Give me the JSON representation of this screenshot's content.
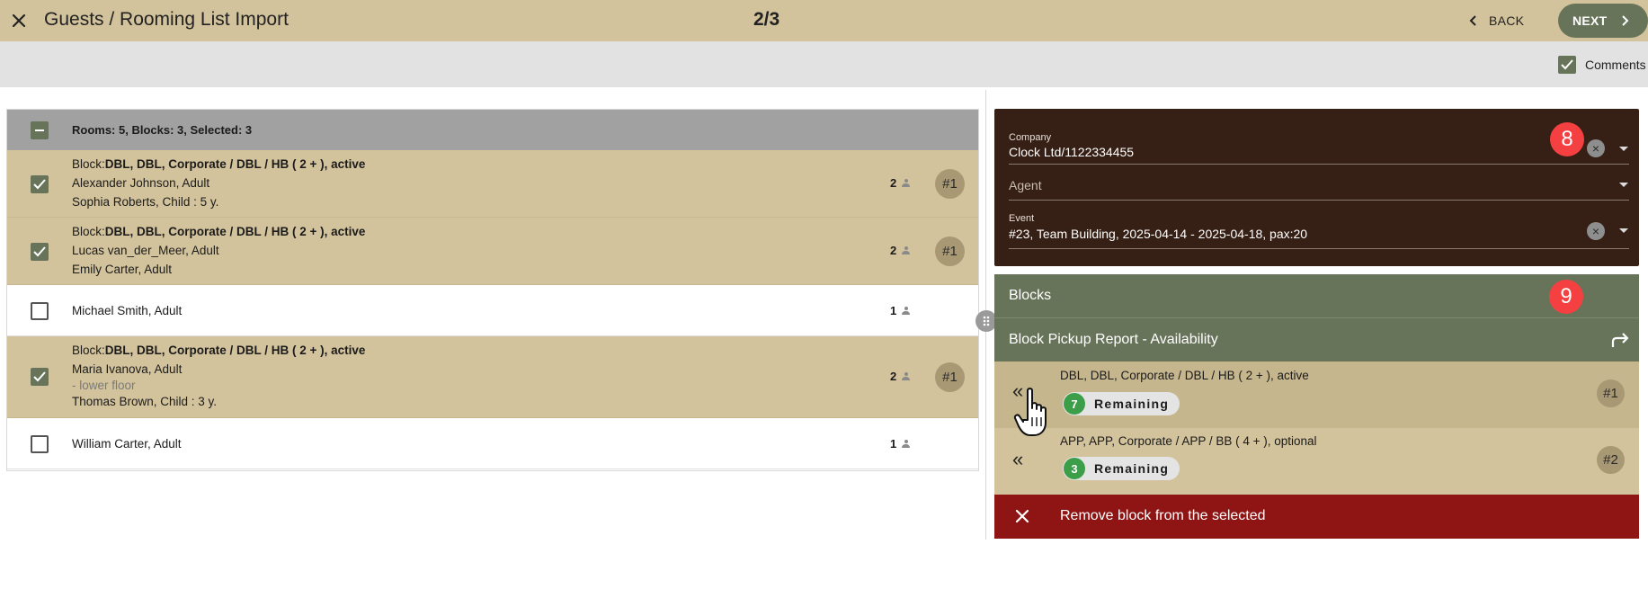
{
  "header": {
    "title": "Guests / Rooming List Import",
    "step": "2/3",
    "back_label": "BACK",
    "next_label": "NEXT"
  },
  "toolbar": {
    "comments_label": "Comments",
    "comments_checked": true
  },
  "rooms": {
    "summary": "Rooms: 5, Blocks: 3, Selected: 3",
    "rows": [
      {
        "selected": true,
        "block_prefix": "Block:",
        "block": "DBL, DBL, Corporate / DBL / HB ( 2 + ), active",
        "guests": [
          "Alexander Johnson, Adult",
          "Sophia Roberts, Child : 5 y."
        ],
        "count": "2",
        "tag": "#1"
      },
      {
        "selected": true,
        "block_prefix": "Block:",
        "block": "DBL, DBL, Corporate / DBL / HB ( 2 + ), active",
        "guests": [
          "Lucas van_der_Meer, Adult",
          "Emily Carter, Adult"
        ],
        "count": "2",
        "tag": "#1"
      },
      {
        "selected": false,
        "guests": [
          "Michael Smith, Adult"
        ],
        "count": "1"
      },
      {
        "selected": true,
        "block_prefix": "Block:",
        "block": "DBL, DBL, Corporate / DBL / HB ( 2 + ), active",
        "guests": [
          "Maria Ivanova, Adult",
          "Thomas Brown, Child : 3 y."
        ],
        "note": "- lower floor",
        "count": "2",
        "tag": "#1"
      },
      {
        "selected": false,
        "guests": [
          "William Carter, Adult"
        ],
        "count": "1"
      }
    ]
  },
  "form": {
    "company_label": "Company",
    "company_value": "Clock Ltd/1122334455",
    "agent_placeholder": "Agent",
    "event_label": "Event",
    "event_value": "#23, Team Building, 2025-04-14 - 2025-04-18, pax:20",
    "step_marker_8": "8"
  },
  "blocks": {
    "header": "Blocks",
    "step_marker_9": "9",
    "pickup_label": "Block Pickup Report - Availability",
    "items": [
      {
        "name": "DBL, DBL, Corporate / DBL / HB ( 2 + ), active",
        "remaining": "7",
        "remaining_label": "Remaining",
        "tag": "#1"
      },
      {
        "name": "APP, APP, Corporate / APP / BB ( 4 + ), optional",
        "remaining": "3",
        "remaining_label": "Remaining",
        "tag": "#2"
      }
    ],
    "remove_label": "Remove block from the selected"
  },
  "icons": {
    "close": "close-icon",
    "back": "chevron-left-icon",
    "next": "chevron-right-icon",
    "person": "person-icon",
    "share": "share-icon",
    "double_chevron": "double-chevron-left-icon"
  },
  "colors": {
    "tan": "#d3c39c",
    "olive": "#68745a",
    "dark_brown": "#361f14",
    "red": "#8f1414",
    "marker_red": "#f44040",
    "green": "#3d9e4a"
  }
}
